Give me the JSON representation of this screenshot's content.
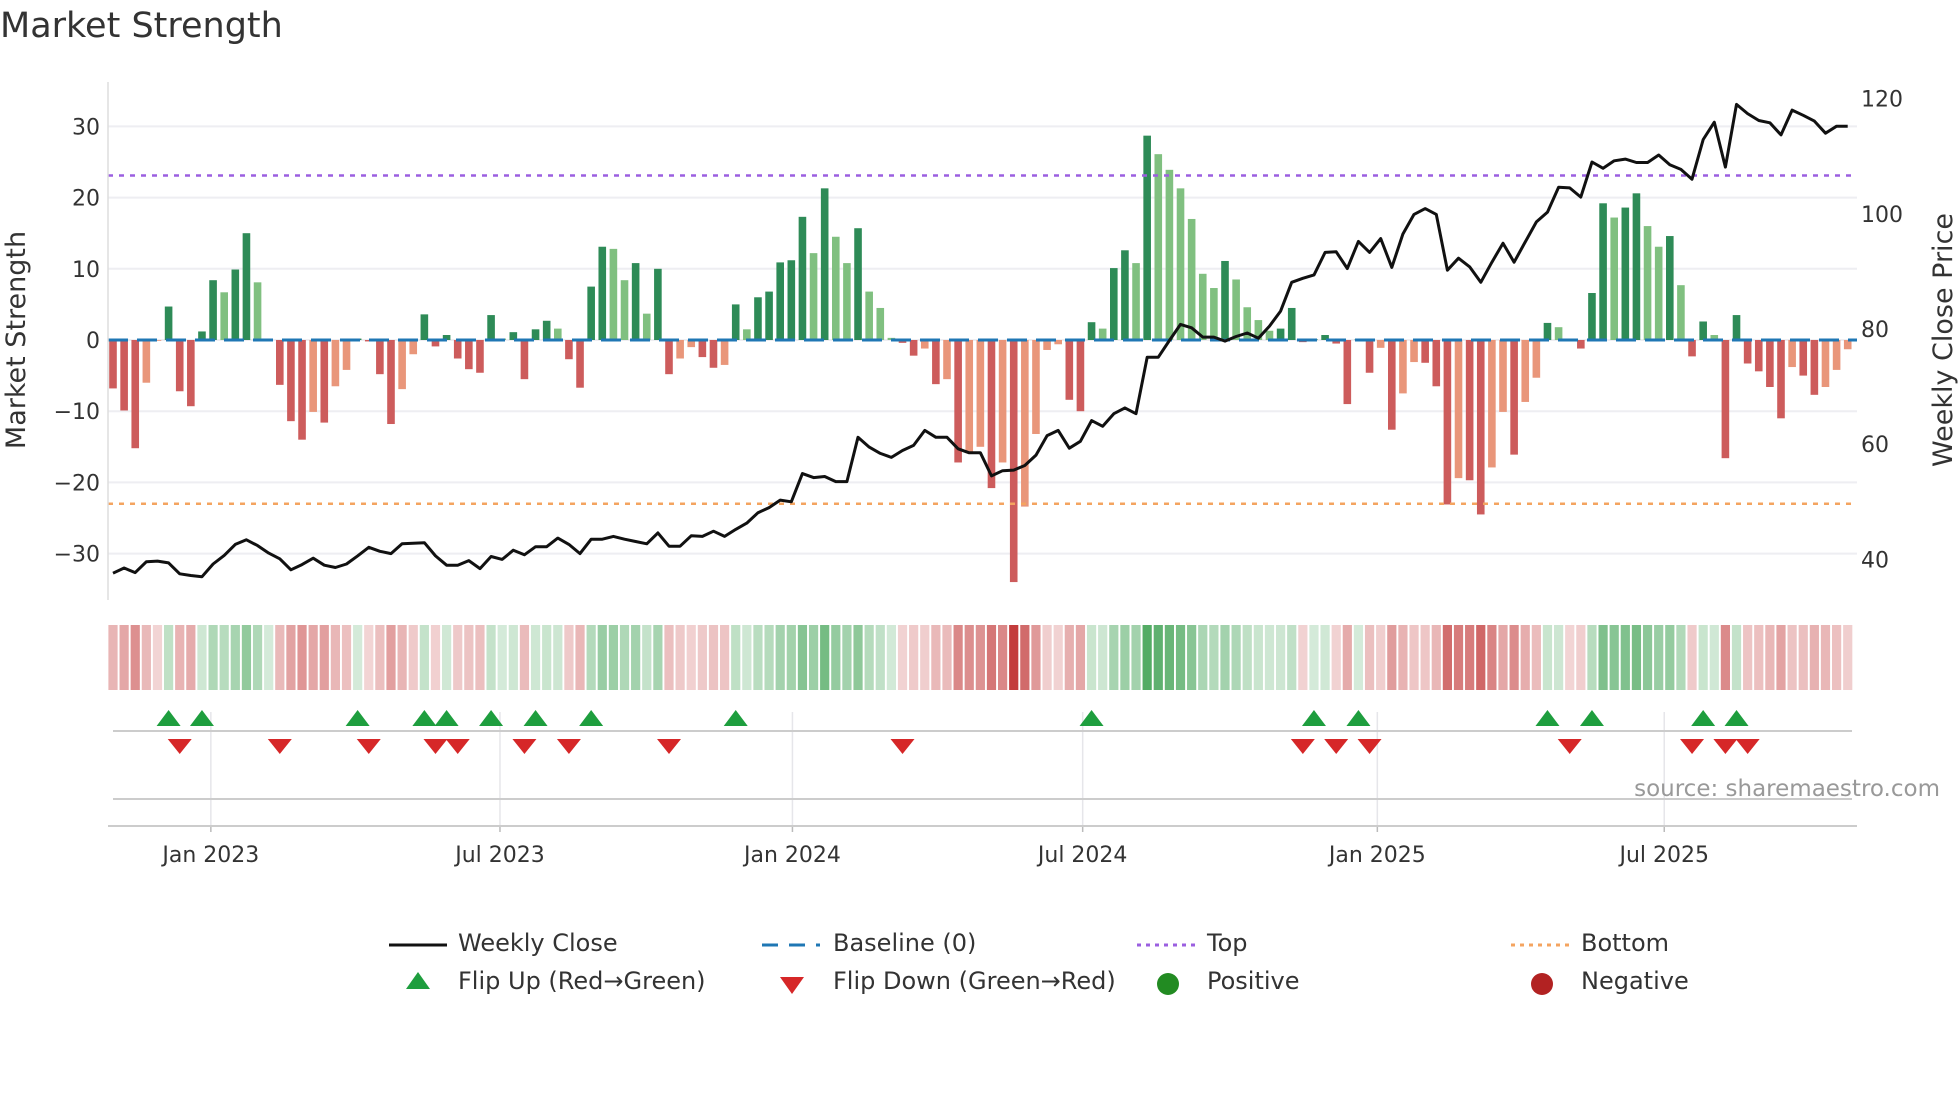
{
  "chart_data": {
    "type": "bar+line",
    "title": "Market Strength",
    "ylabel_left": "Market Strength",
    "ylabel_right": "Weekly Close Price",
    "ylim_left": [
      -36.5,
      36.3
    ],
    "ylim_right": [
      32.9,
      122.9
    ],
    "yticks_left": [
      {
        "v": -30,
        "label": "−30"
      },
      {
        "v": -20,
        "label": "−20"
      },
      {
        "v": -10,
        "label": "−10"
      },
      {
        "v": 0,
        "label": "0"
      },
      {
        "v": 10,
        "label": "10"
      },
      {
        "v": 20,
        "label": "20"
      },
      {
        "v": 30,
        "label": "30"
      }
    ],
    "yticks_right": [
      {
        "v": 40,
        "label": "40"
      },
      {
        "v": 60,
        "label": "60"
      },
      {
        "v": 80,
        "label": "80"
      },
      {
        "v": 100,
        "label": "100"
      },
      {
        "v": 120,
        "label": "120"
      }
    ],
    "x_unit": "week index",
    "xticks": [
      {
        "week": 8.8,
        "label": "Jan 2023"
      },
      {
        "week": 34.8,
        "label": "Jul 2023"
      },
      {
        "week": 61.1,
        "label": "Jan 2024"
      },
      {
        "week": 87.2,
        "label": "Jul 2024"
      },
      {
        "week": 113.7,
        "label": "Jan 2025"
      },
      {
        "week": 139.5,
        "label": "Jul 2025"
      }
    ],
    "top_level": 23.1,
    "bottom_level": -23.0,
    "baseline": 0,
    "strength": [
      -6.8,
      -9.9,
      -15.2,
      -6.0,
      -0.1,
      4.7,
      -7.2,
      -9.3,
      1.2,
      8.4,
      6.7,
      9.9,
      15.0,
      8.1,
      0.1,
      -6.3,
      -11.4,
      -14.0,
      -10.1,
      -11.6,
      -6.5,
      -4.2,
      0.2,
      -0.2,
      -4.8,
      -11.8,
      -6.9,
      -2.0,
      3.6,
      -0.9,
      0.7,
      -2.6,
      -4.1,
      -4.6,
      3.5,
      0.2,
      1.1,
      -5.5,
      1.5,
      2.7,
      1.6,
      -2.7,
      -6.7,
      7.5,
      13.1,
      12.8,
      8.4,
      10.8,
      3.7,
      10.0,
      -4.8,
      -2.6,
      -1.0,
      -2.4,
      -3.9,
      -3.5,
      5.0,
      1.5,
      6.0,
      6.8,
      10.9,
      11.2,
      17.3,
      12.2,
      21.3,
      14.5,
      10.8,
      15.7,
      6.8,
      4.5,
      0.3,
      -0.4,
      -2.2,
      -1.2,
      -6.2,
      -5.5,
      -17.2,
      -15.9,
      -15.0,
      -20.8,
      -17.2,
      -34.0,
      -23.4,
      -13.2,
      -1.4,
      -0.6,
      -8.4,
      -10.0,
      2.5,
      1.6,
      10.1,
      12.6,
      10.8,
      28.7,
      26.1,
      23.9,
      21.3,
      17.0,
      9.3,
      7.3,
      11.1,
      8.5,
      4.6,
      2.8,
      1.3,
      1.6,
      4.5,
      -0.3,
      0.1,
      0.7,
      -0.5,
      -9.0,
      0.1,
      -4.6,
      -1.1,
      -12.6,
      -7.5,
      -3.1,
      -3.2,
      -6.5,
      -23.1,
      -19.4,
      -19.7,
      -24.5,
      -17.9,
      -10.1,
      -16.1,
      -8.7,
      -5.3,
      2.4,
      1.8,
      -0.1,
      -1.2,
      6.6,
      19.2,
      17.2,
      18.6,
      20.6,
      16.0,
      13.1,
      14.6,
      7.7,
      -2.3,
      2.6,
      0.7,
      -16.6,
      3.5,
      -3.3,
      -4.4,
      -6.6,
      -11.0,
      -3.8,
      -5.0,
      -7.7,
      -6.6,
      -4.2,
      -1.3
    ],
    "weekly_close": [
      37.6,
      38.5,
      37.7,
      39.6,
      39.7,
      39.4,
      37.5,
      37.2,
      37.0,
      39.2,
      40.7,
      42.6,
      43.4,
      42.4,
      41.1,
      40.1,
      38.2,
      39.1,
      40.2,
      39.0,
      38.6,
      39.2,
      40.6,
      42.1,
      41.4,
      41.0,
      42.7,
      42.8,
      42.9,
      40.6,
      39.0,
      39.0,
      39.8,
      38.4,
      40.5,
      40.0,
      41.6,
      40.8,
      42.2,
      42.2,
      43.7,
      42.6,
      41.0,
      43.5,
      43.5,
      44.0,
      43.5,
      43.1,
      42.7,
      44.6,
      42.3,
      42.3,
      44.1,
      44.0,
      44.9,
      44.0,
      45.2,
      46.3,
      48.1,
      49.0,
      50.3,
      50.0,
      54.9,
      54.2,
      54.4,
      53.5,
      53.5,
      61.2,
      59.5,
      58.4,
      57.7,
      58.9,
      59.8,
      62.4,
      61.2,
      61.2,
      59.2,
      58.5,
      58.5,
      54.5,
      55.4,
      55.5,
      56.3,
      58.1,
      61.5,
      62.4,
      59.3,
      60.5,
      64.1,
      63.1,
      65.3,
      66.3,
      65.3,
      75.1,
      75.1,
      78.0,
      80.8,
      80.2,
      78.6,
      78.6,
      77.9,
      78.7,
      79.3,
      78.4,
      80.5,
      83.1,
      88.1,
      88.8,
      89.4,
      93.3,
      93.4,
      90.5,
      95.2,
      93.3,
      95.7,
      90.7,
      96.5,
      99.9,
      100.9,
      99.9,
      90.2,
      92.3,
      90.8,
      88.1,
      91.6,
      94.9,
      91.6,
      95.1,
      98.6,
      100.3,
      104.6,
      104.5,
      102.9,
      109.0,
      107.9,
      109.2,
      109.5,
      108.9,
      108.9,
      110.2,
      108.5,
      107.7,
      106.0,
      112.9,
      115.9,
      108.1,
      119.0,
      117.4,
      116.2,
      115.8,
      113.7,
      118.0,
      117.1,
      116.1,
      114.0,
      115.2,
      115.2
    ],
    "legend": {
      "weekly_close": "Weekly Close",
      "baseline": "Baseline (0)",
      "top": "Top",
      "bottom": "Bottom",
      "flip_up": "Flip Up (Red→Green)",
      "flip_down": "Flip Down (Green→Red)",
      "positive": "Positive",
      "negative": "Negative"
    },
    "source": "source: sharemaestro.com",
    "colors": {
      "pos_strong": "#2e8b57",
      "pos_weak": "#80c080",
      "neg_strong": "#cd5c5c",
      "neg_weak": "#e9967a",
      "line": "#111111",
      "baseline": "#1f77b4",
      "top": "#9b5fe0",
      "bottom": "#f4a460",
      "flip_up": "#1e9e3e",
      "flip_down": "#d62728",
      "positive": "#228b22",
      "negative": "#b22222"
    }
  }
}
